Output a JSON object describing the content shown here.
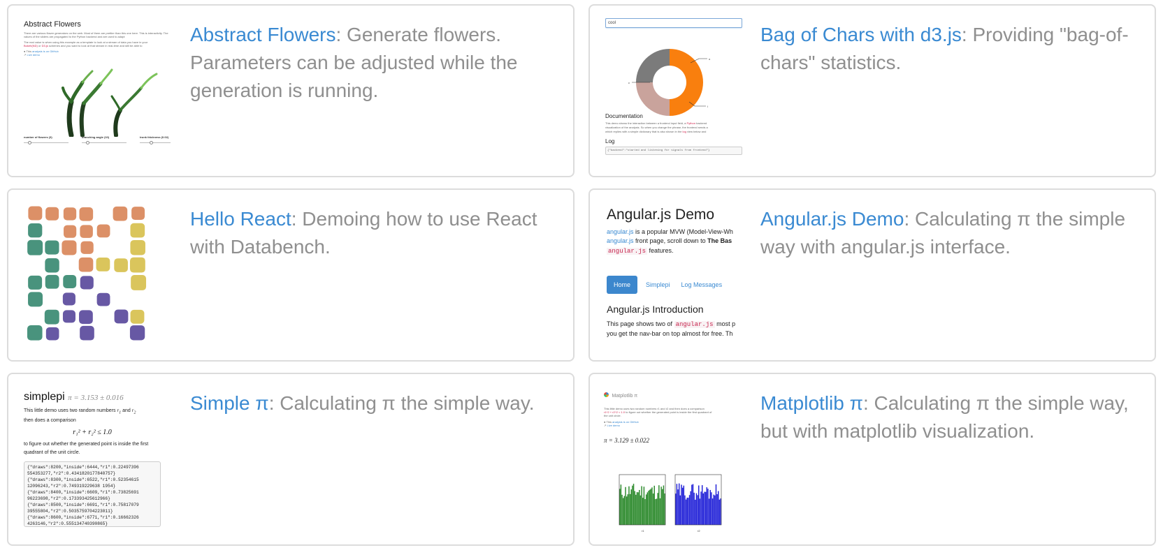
{
  "colors": {
    "link": "#3a8ad2",
    "text": "#8f8f8f",
    "border": "#dcdcdc",
    "angular_button": "#3c87cd"
  },
  "cards": {
    "abstract_flowers": {
      "title": "Abstract Flowers",
      "description": ": Generate flowers. Parameters can be adjusted while the generation is running.",
      "thumb": {
        "title": "Abstract Flowers",
        "para1": "There are various flower generators on the web. Most of them are prettier than this one here. This is interactivity. The values of the sliders are propagated to the Python backend and are used to adapt",
        "para2": "The real value is when using this example as a template to look at a stream of data you have in your",
        "code1": "Bokeh(ND)",
        "code2": "D3.js",
        "para2b": "schemes and you want to look at that stream in real-time and still be able to",
        "link1_pre": "This",
        "link1": "analysis is on GitHub",
        "link2": "Live demo",
        "slider1": "number of flowers (3)",
        "slider2": "branching angle (10)",
        "slider3": "trunk thickness (0.02)"
      }
    },
    "bag_of_chars": {
      "title": "Bag of Chars with d3.js",
      "description": ": Providing \"bag-of-chars\" statistics.",
      "thumb": {
        "input_value": "cool",
        "doc_heading": "Documentation",
        "doc_text_1": "This demo shows the interaction between a frontend input field, a",
        "doc_code_1": "Python",
        "doc_text_1b": "backend",
        "doc_text_2": "visualization of the analysis. So when you change the phrase, the frontend sends a",
        "doc_text_3": "which replies with a simple dictionary that is also shown in the",
        "doc_code_2": "log",
        "doc_text_3b": "view below and",
        "log_heading": "Log",
        "log_line": "{\"backend\":\"started and listening for signals from frontend\"}",
        "slices": [
          {
            "label": "o",
            "value": 2
          },
          {
            "label": "c",
            "value": 1
          },
          {
            "label": "l",
            "value": 1
          }
        ]
      }
    },
    "hello_react": {
      "title": "Hello React",
      "description": ": Demoing how to use React with Databench."
    },
    "angular_demo": {
      "title": "Angular.js Demo",
      "description": ": Calculating π the simple way with angular.js interface.",
      "thumb": {
        "heading": "Angular.js Demo",
        "line1_link": "angular.js",
        "line1_text": "is a popular MVW (Model-View-Wh",
        "line2_link": "angular.js",
        "line2_text": "front page, scroll down to",
        "line2_bold": "The Bas",
        "line3_code": "angular.js",
        "line3_text": "features.",
        "nav_home": "Home",
        "nav_simplepi": "Simplepi",
        "nav_log": "Log Messages",
        "intro_heading": "Angular.js Introduction",
        "intro_text_1": "This page shows two of",
        "intro_code": "angular.js",
        "intro_text_1b": "most p",
        "intro_text_2": "you get the nav-bar on top almost for free. Th"
      }
    },
    "simple_pi": {
      "title": "Simple π",
      "description": ": Calculating π the simple way.",
      "thumb": {
        "heading": "simplepi",
        "estimate": "π = 3.153 ± 0.016",
        "text_1": "This little demo uses two random numbers",
        "r1": "r",
        "text_1b": "and",
        "text_2": "then does a comparison",
        "formula": "r₁² + r₂² ≤ 1.0",
        "text_3": "to figure out whether the generated point is inside the first",
        "text_4": "quadrant of the unit circle.",
        "log_lines": [
          "{\"draws\":8200,\"inside\":6444,\"r1\":0.22497396",
          "554353277,\"r2\":0.4341820177840757}",
          "{\"draws\":8300,\"inside\":6522,\"r1\":0.52354615",
          "12096243,\"r2\":0.749319229638 1954}",
          "{\"draws\":8400,\"inside\":6609,\"r1\":0.73825691",
          "96223698,\"r2\":0.173393425612966}",
          "{\"draws\":8500,\"inside\":6691,\"r1\":0.75817079",
          "39555804,\"r2\":0.5035759704223011}",
          "{\"draws\":8600,\"inside\":6771,\"r1\":0.16662326",
          "4263146,\"r2\":0.555134740390865}"
        ]
      }
    },
    "matplotlib_pi": {
      "title": "Matplotlib π",
      "description": ": Calculating π the simple way, but with matplotlib visualization.",
      "thumb": {
        "heading": "Matplotlib π",
        "text_1": "This little demo uses two random numbers r1 and r2 and then does a comparison",
        "code": "r1^2 + r2^2 < 1.0",
        "text_2": "to figure out whether the generated point is inside the first quadrant of",
        "text_3": "the unit circle.",
        "link1": "analysis is on GitHub",
        "link2": "Live demo",
        "estimate": "π = 3.129 ± 0.022",
        "xlabel1": "r1",
        "xlabel2": "r2"
      }
    }
  }
}
